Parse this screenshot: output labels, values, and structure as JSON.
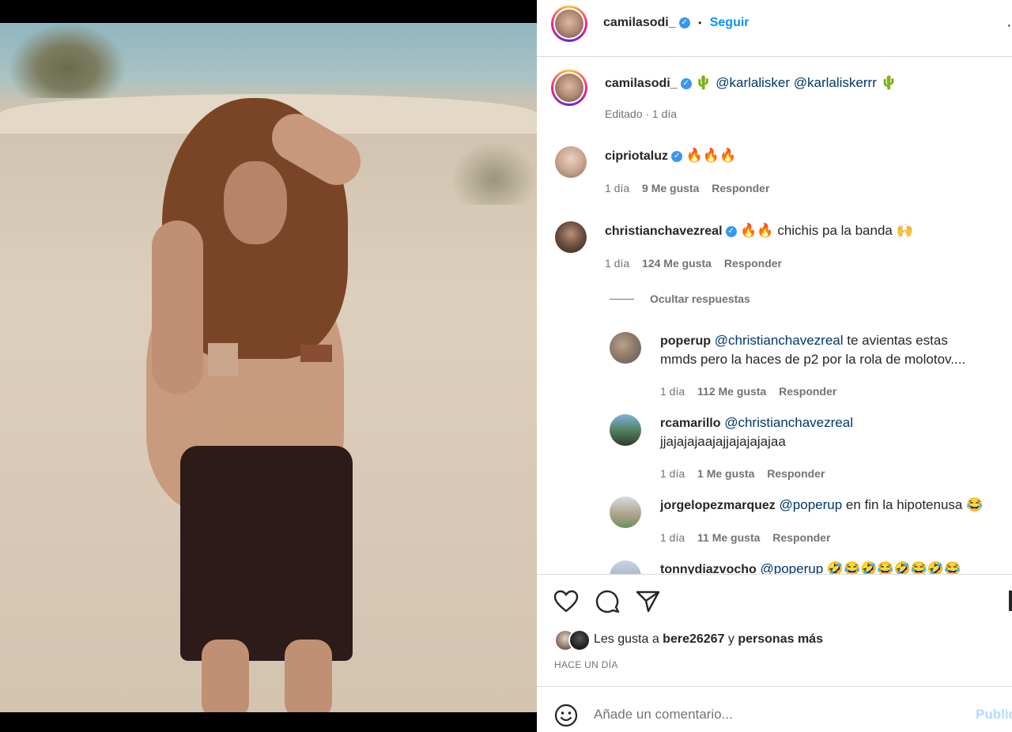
{
  "post": {
    "author": "camilasodi_",
    "follow_label": "Seguir",
    "dot": "•",
    "caption_prefix": "🌵",
    "caption_mentions": [
      "@karlalisker",
      "@karlaliskerrr"
    ],
    "caption_suffix": "🌵",
    "caption_meta": "Editado · 1 día"
  },
  "comments": [
    {
      "user": "cipriotaluz",
      "verified": true,
      "text": "🔥🔥🔥",
      "time": "1 día",
      "likes": "9 Me gusta",
      "reply": "Responder"
    },
    {
      "user": "christianchavezreal",
      "verified": true,
      "text": "🔥🔥 chichis pa la banda 🙌",
      "time": "1 día",
      "likes": "124 Me gusta",
      "reply": "Responder"
    }
  ],
  "hide_replies": "Ocultar respuestas",
  "replies": [
    {
      "user": "poperup",
      "mention": "@christianchavezreal",
      "text": " te avientas estas",
      "text2": "mmds pero la haces de p2 por la rola de molotov....",
      "time": "1 día",
      "likes": "112 Me gusta",
      "reply": "Responder"
    },
    {
      "user": "rcamarillo",
      "mention": "@christianchavezreal",
      "text": "",
      "text2": "jjajajajaajajjajajajajaa",
      "time": "1 día",
      "likes": "1 Me gusta",
      "reply": "Responder"
    },
    {
      "user": "jorgelopezmarquez",
      "mention": "@poperup",
      "text": " en fin la hipotenusa 😂",
      "time": "1 día",
      "likes": "11 Me gusta",
      "reply": "Responder"
    },
    {
      "user": "tonnydiazvocho",
      "mention": "@poperup",
      "text": " 🤣😂🤣😂🤣😂🤣😂"
    }
  ],
  "likes_line": {
    "prefix": "Les gusta a ",
    "user": "bere26267",
    "mid": " y ",
    "rest": "personas más"
  },
  "timestamp": "HACE UN DÍA",
  "comment_input": {
    "placeholder": "Añade un comentario...",
    "publish": "Publicar"
  },
  "icons": [
    "heart-icon",
    "comment-icon",
    "share-icon",
    "bookmark-icon",
    "emoji-icon",
    "verified-icon",
    "more-icon"
  ],
  "colors": {
    "link": "#00376b",
    "accent": "#0095f6",
    "verified": "#3897f0",
    "muted": "#737373"
  }
}
